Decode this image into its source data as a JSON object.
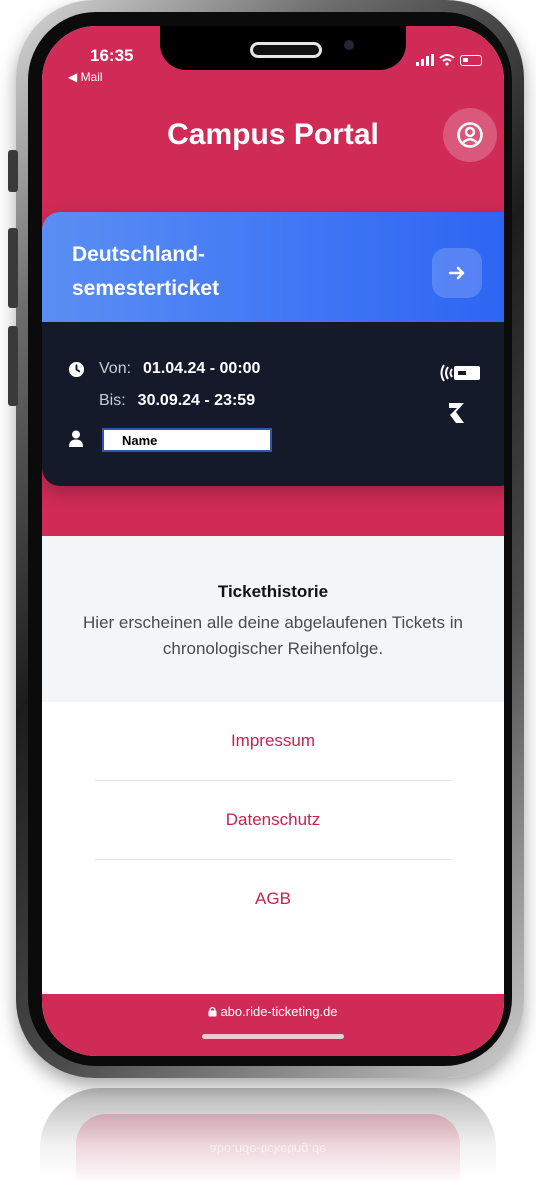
{
  "status": {
    "time": "16:35",
    "back_label": "◀ Mail"
  },
  "header": {
    "title": "Campus Portal",
    "profile_icon": "user-circle-icon"
  },
  "ticket": {
    "title_line1": "Deutschland-",
    "title_line2": "semesterticket",
    "from_label": "Von:",
    "from_value": "01.04.24 - 00:00",
    "to_label": "Bis:",
    "to_value": "30.09.24 - 23:59",
    "name": "Name",
    "head_color": "#3f77f5",
    "body_color": "#151a2b"
  },
  "history": {
    "title": "Tickethistorie",
    "description": "Hier erscheinen alle deine abgelaufenen Tickets in chronologischer Reihenfolge."
  },
  "links": [
    "Impressum",
    "Datenschutz",
    "AGB"
  ],
  "footer": {
    "url": "abo.ride-ticketing.de"
  },
  "colors": {
    "brand": "#d02b56",
    "link": "#c4244f"
  }
}
